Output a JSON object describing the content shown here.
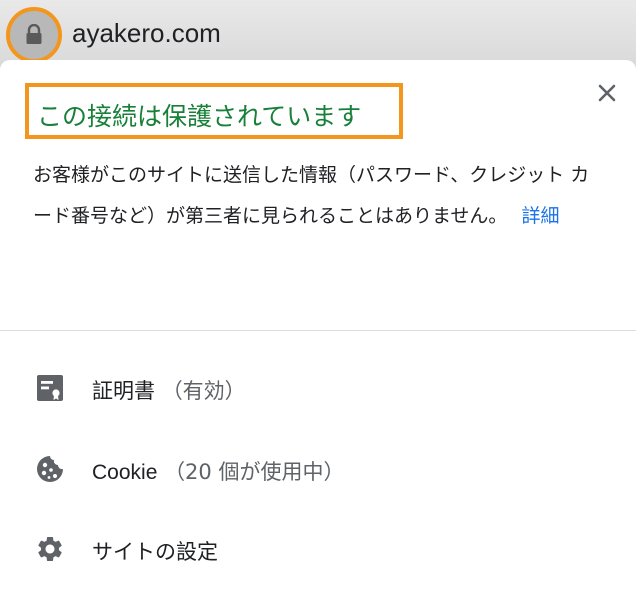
{
  "address_bar": {
    "domain": "ayakero.com",
    "lock_icon": "lock-icon"
  },
  "popup": {
    "title": "この接続は保護されています",
    "description": "お客様がこのサイトに送信した情報（パスワード、クレジット カード番号など）が第三者に見られることはありません。",
    "details_link": "詳細",
    "close_icon": "close-icon"
  },
  "menu": {
    "certificate": {
      "label": "証明書",
      "status": "（有効）",
      "icon": "certificate-icon"
    },
    "cookie": {
      "label": "Cookie",
      "status": "（20 個が使用中）",
      "icon": "cookie-icon"
    },
    "site_settings": {
      "label": "サイトの設定",
      "icon": "gear-icon"
    }
  },
  "colors": {
    "title_green": "#188038",
    "link_blue": "#1a73e8",
    "highlight_orange": "#f2961d",
    "icon_gray": "#5f6368"
  }
}
